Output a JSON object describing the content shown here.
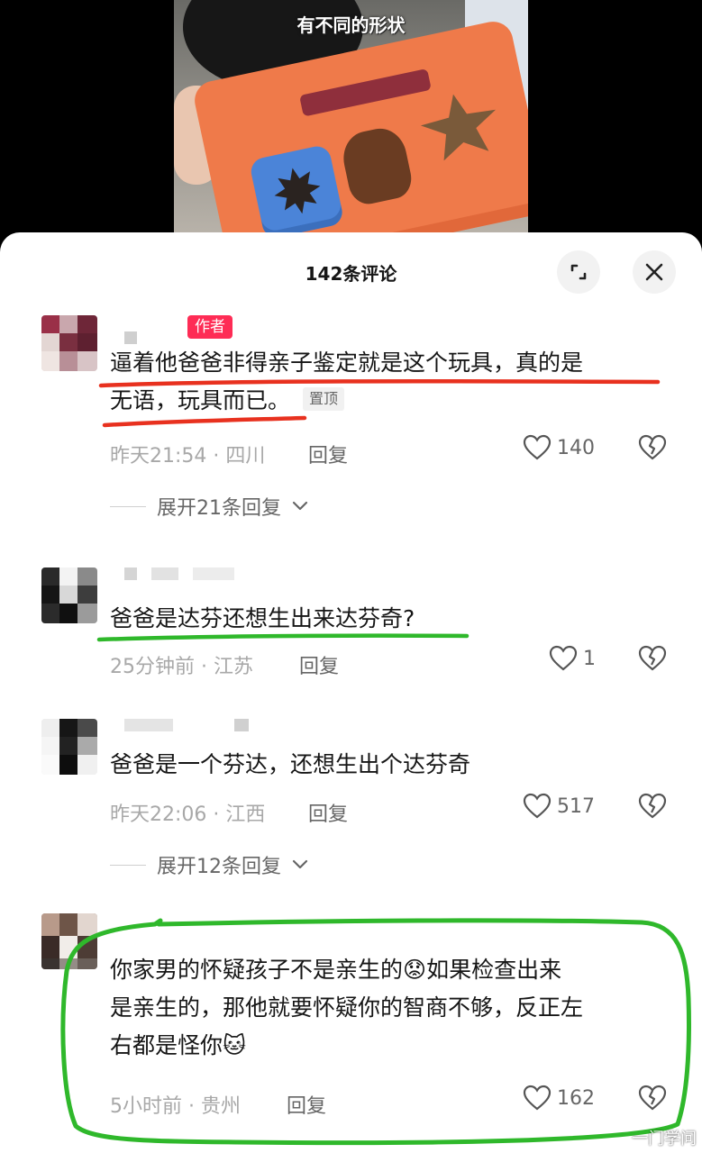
{
  "video": {
    "caption": "有不同的形状"
  },
  "header": {
    "title": "142条评论",
    "expand_icon": "expand-icon",
    "close_icon": "close-icon"
  },
  "colors": {
    "author_tag": "#fe2c55",
    "red_annotation": "#e8311f",
    "green_annotation": "#2fb82b"
  },
  "comments": [
    {
      "author_badge": "作者",
      "line1": "逼着他爸爸非得亲子鉴定就是这个玩具，真的是",
      "line2": "无语，玩具而已。",
      "pin_label": "置顶",
      "meta": "昨天21:54 · 四川",
      "reply_label": "回复",
      "likes": "140",
      "expand_replies": "展开21条回复"
    },
    {
      "text": "爸爸是达芬还想生出来达芬奇?",
      "meta": "25分钟前 · 江苏",
      "reply_label": "回复",
      "likes": "1"
    },
    {
      "text": "爸爸是一个芬达，还想生出个达芬奇",
      "meta": "昨天22:06 · 江西",
      "reply_label": "回复",
      "likes": "517",
      "expand_replies": "展开12条回复"
    },
    {
      "line1": "你家男的怀疑孩子不是亲生的",
      "emoji1": "😟",
      "line1b": "如果检查出来",
      "line2": "是亲生的，那他就要怀疑你的智商不够，反正左",
      "line3": "右都是怪你",
      "emoji2": "🐱",
      "meta": "5小时前 · 贵州",
      "reply_label": "回复",
      "likes": "162"
    }
  ],
  "watermark": "一门学问"
}
